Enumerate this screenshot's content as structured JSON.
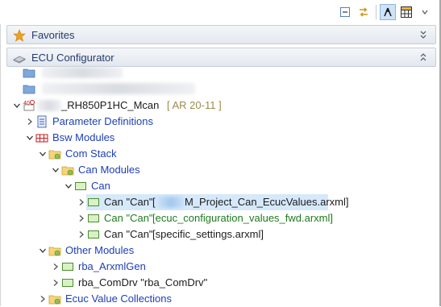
{
  "toolbar": {
    "icons": [
      "collapse-all-icon",
      "link-with-editor-icon",
      "hierarchy-filter-icon",
      "table-view-icon"
    ]
  },
  "favorites": {
    "title": "Favorites"
  },
  "ecu_configurator": {
    "title": "ECU Configurator"
  },
  "project": {
    "name": "_RH850P1HC_Mcan",
    "version": "[ AR 20-11 ]"
  },
  "tree": {
    "parameter_definitions": "Parameter Definitions",
    "bsw_modules": "Bsw Modules",
    "com_stack": "Com Stack",
    "can_modules": "Can Modules",
    "can": "Can",
    "can_item1": {
      "name": "Can \"Can\"",
      "file": "M_Project_Can_EcucValues.arxml]",
      "prefix": "["
    },
    "can_item2": {
      "name": "Can \"Can\"",
      "file": "[ecuc_configuration_values_fwd.arxml]"
    },
    "can_item3": {
      "name": "Can \"Can\"",
      "file": "[specific_settings.arxml]"
    },
    "other_modules": "Other Modules",
    "rba_arxmlgen": "rba_ArxmlGen",
    "rba_comdrv": "rba_ComDrv \"rba_ComDrv\"",
    "ecuc_value_collections": "Ecuc Value Collections"
  },
  "colors": {
    "link_blue": "#1e3fb4",
    "file_green": "#1f7a1f",
    "selection": "#d6e9fb",
    "section_title": "#243a6e"
  }
}
